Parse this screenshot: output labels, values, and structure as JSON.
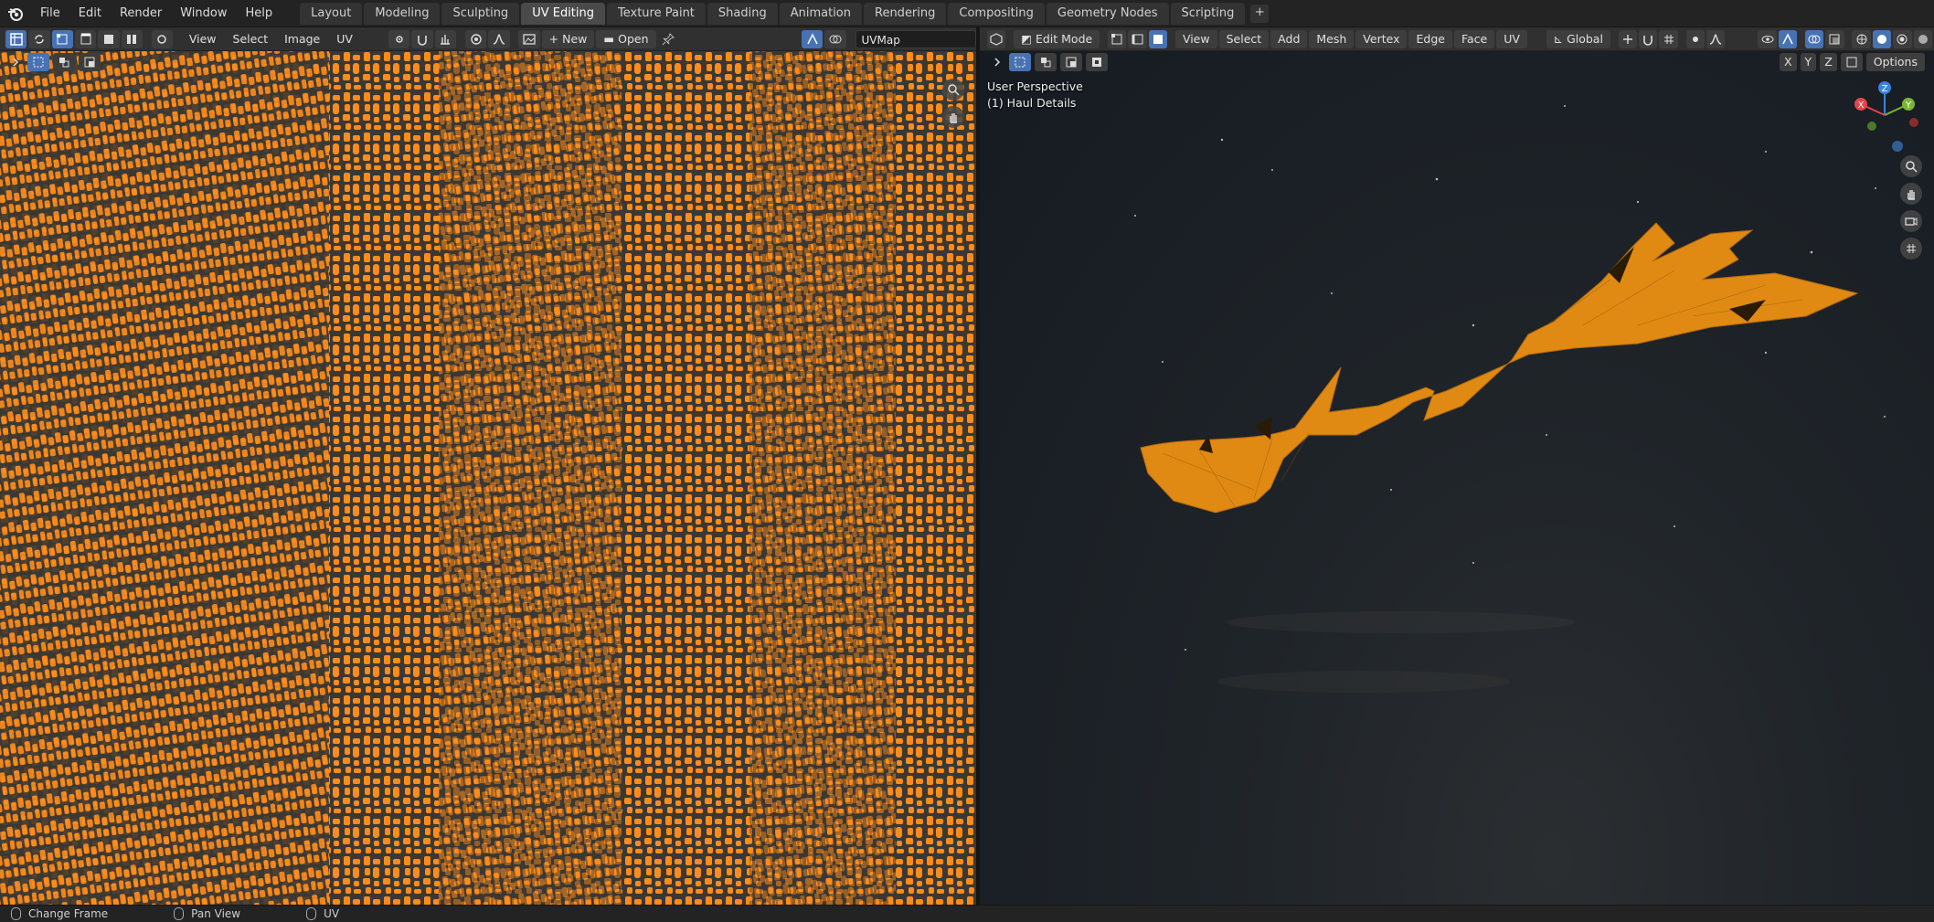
{
  "menu": {
    "file": "File",
    "edit": "Edit",
    "render": "Render",
    "window": "Window",
    "help": "Help"
  },
  "workspaces": [
    {
      "label": "Layout",
      "active": false
    },
    {
      "label": "Modeling",
      "active": false
    },
    {
      "label": "Sculpting",
      "active": false
    },
    {
      "label": "UV Editing",
      "active": true
    },
    {
      "label": "Texture Paint",
      "active": false
    },
    {
      "label": "Shading",
      "active": false
    },
    {
      "label": "Animation",
      "active": false
    },
    {
      "label": "Rendering",
      "active": false
    },
    {
      "label": "Compositing",
      "active": false
    },
    {
      "label": "Geometry Nodes",
      "active": false
    },
    {
      "label": "Scripting",
      "active": false
    }
  ],
  "uv_header": {
    "view": "View",
    "select": "Select",
    "image": "Image",
    "uv": "UV",
    "new": "New",
    "open": "Open",
    "uvmap": "UVMap"
  },
  "vp_header": {
    "mode": "Edit Mode",
    "view": "View",
    "select": "Select",
    "add": "Add",
    "mesh": "Mesh",
    "vertex": "Vertex",
    "edge": "Edge",
    "face": "Face",
    "uv": "UV",
    "orientation": "Global",
    "x": "X",
    "y": "Y",
    "z": "Z",
    "options": "Options"
  },
  "viewport": {
    "perspective": "User Perspective",
    "object": "(1) Haul Details",
    "gizmo": {
      "x": "X",
      "y": "Y",
      "z": "Z"
    }
  },
  "status": {
    "left": "Change Frame",
    "middle": "Pan View",
    "right": "UV"
  },
  "colors": {
    "accent": "#4772b3",
    "uv_orange": "#ff8c1a",
    "mesh_orange": "#e08a14",
    "gizmo_x": "#e0454a",
    "gizmo_y": "#7ab536",
    "gizmo_z": "#3b83d8"
  }
}
